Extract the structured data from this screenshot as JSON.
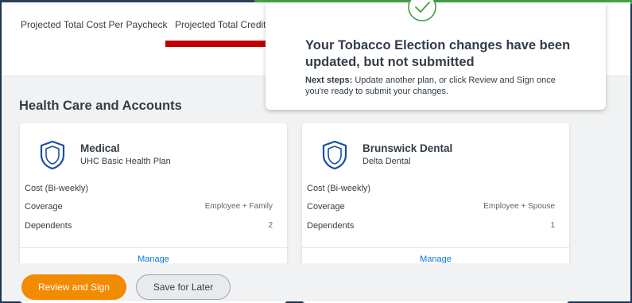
{
  "summary": {
    "cost_per_paycheck_label": "Projected Total Cost Per Paycheck",
    "total_credits_label": "Projected Total Credits"
  },
  "toast": {
    "title": "Your Tobacco Election changes have been updated, but not submitted",
    "next_steps_label": "Next steps:",
    "next_steps_text": " Update another plan, or click Review and Sign once you're ready to submit your changes."
  },
  "section": {
    "title": "Health Care and Accounts"
  },
  "cards": [
    {
      "name": "Medical",
      "plan": "UHC Basic Health Plan",
      "cost_label": "Cost (Bi-weekly)",
      "coverage_label": "Coverage",
      "coverage_value": "Employee + Family",
      "dependents_label": "Dependents",
      "dependents_value": "2",
      "manage_label": "Manage"
    },
    {
      "name": "Brunswick Dental",
      "plan": "Delta Dental",
      "cost_label": "Cost (Bi-weekly)",
      "coverage_label": "Coverage",
      "coverage_value": "Employee + Spouse",
      "dependents_label": "Dependents",
      "dependents_value": "1",
      "manage_label": "Manage"
    }
  ],
  "footer": {
    "review_label": "Review and Sign",
    "save_label": "Save for Later"
  },
  "colors": {
    "primary_button": "#f38b00",
    "link": "#0875e1",
    "success": "#43a047",
    "arrow": "#c00000",
    "shield": "#1a4fa0"
  },
  "icons": [
    "check-circle-icon",
    "shield-icon",
    "arrow-right-annotation"
  ]
}
